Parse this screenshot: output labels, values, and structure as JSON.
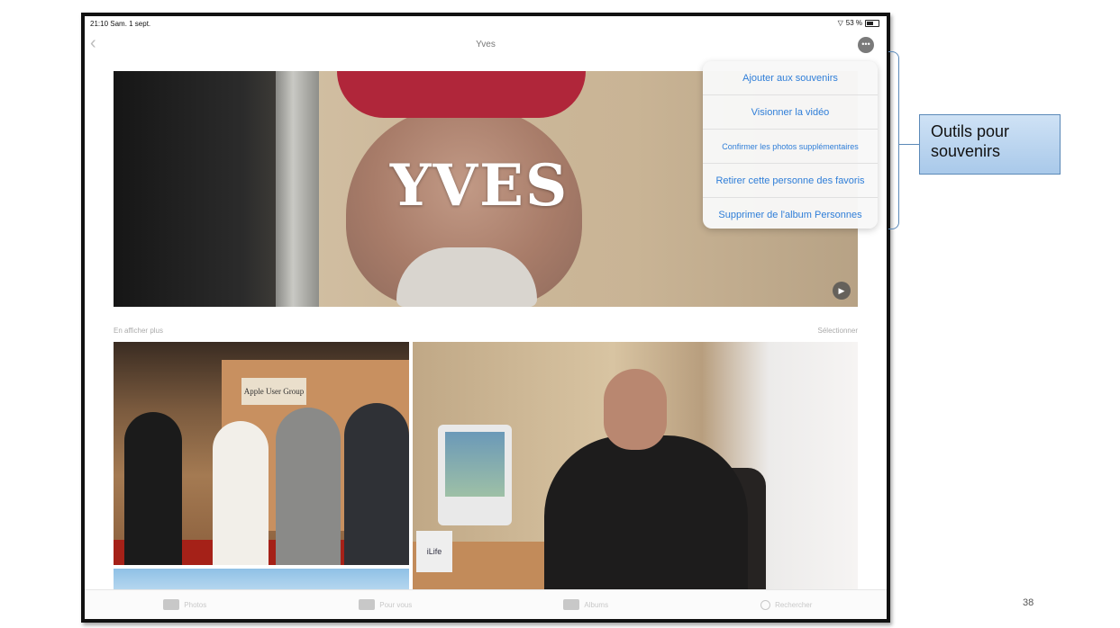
{
  "status_bar": {
    "time_date": "21:10  Sam. 1 sept.",
    "battery": "53 %"
  },
  "nav": {
    "title": "Yves",
    "back_icon": "chevron-left-icon",
    "more_icon": "ellipsis-circle-icon"
  },
  "hero": {
    "title": "YVES",
    "play_icon": "play-icon"
  },
  "menu": {
    "items": [
      "Ajouter aux souvenirs",
      "Visionner la vidéo",
      "Confirmer les photos supplémentaires",
      "Retirer cette personne des favoris",
      "Supprimer de l'album Personnes"
    ]
  },
  "section": {
    "show_more": "En afficher plus",
    "select": "Sélectionner"
  },
  "photos": {
    "sign_text": "Apple User Group",
    "ilife_text": "iLife"
  },
  "tabbar": {
    "tabs": [
      "Photos",
      "Pour vous",
      "Albums",
      "Rechercher"
    ]
  },
  "annotation": {
    "callout": "Outils pour souvenirs",
    "slide_number": "38"
  },
  "colors": {
    "menu_text": "#2f7ed8",
    "callout_fill": "#bcd6f0",
    "callout_border": "#5b89b8"
  }
}
